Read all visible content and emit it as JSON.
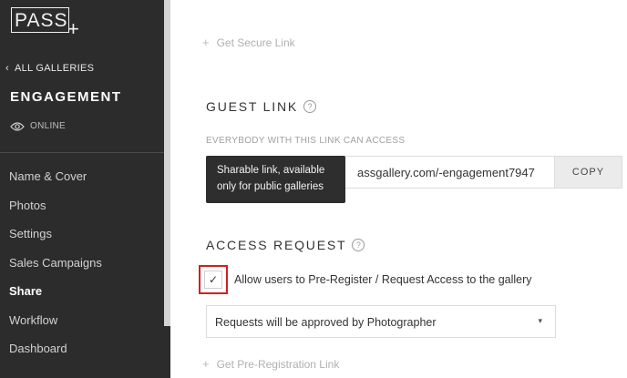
{
  "sidebar": {
    "logo_text": "PASS",
    "logo_plus": "+",
    "back_label": "ALL GALLERIES",
    "gallery_title": "ENGAGEMENT",
    "status": "ONLINE",
    "nav": [
      {
        "label": "Name & Cover"
      },
      {
        "label": "Photos"
      },
      {
        "label": "Settings"
      },
      {
        "label": "Sales Campaigns"
      },
      {
        "label": "Share",
        "active": true
      },
      {
        "label": "Workflow"
      },
      {
        "label": "Dashboard"
      }
    ]
  },
  "main": {
    "secure_link_label": "Get Secure Link",
    "guest_link": {
      "title": "GUEST LINK",
      "help": "?",
      "caption": "EVERYBODY WITH THIS LINK CAN ACCESS",
      "url_visible": "assgallery.com/-engagement7947",
      "copy_label": "COPY",
      "tooltip": "Sharable link, available only for public galleries"
    },
    "access_request": {
      "title": "ACCESS REQUEST",
      "help": "?",
      "checkbox_checked": true,
      "checkbox_mark": "✓",
      "checkbox_label": "Allow users to Pre-Register / Request Access to the gallery",
      "select_value": "Requests will be approved by Photographer",
      "select_caret": "▾"
    },
    "pre_reg_link_label": "Get Pre-Registration Link"
  },
  "colors": {
    "sidebar_bg": "#2c2c2c",
    "highlight_border": "#d32020",
    "tooltip_bg": "#2e2e2e"
  }
}
